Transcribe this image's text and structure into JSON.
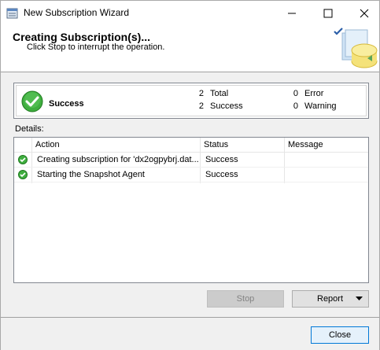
{
  "window": {
    "title": "New Subscription Wizard"
  },
  "header": {
    "title": "Creating Subscription(s)...",
    "subtitle": "Click Stop to interrupt the operation."
  },
  "summary": {
    "status": "Success",
    "total_count": "2",
    "total_label": "Total",
    "success_count": "2",
    "success_label": "Success",
    "error_count": "0",
    "error_label": "Error",
    "warning_count": "0",
    "warning_label": "Warning"
  },
  "details": {
    "label": "Details:",
    "columns": {
      "action": "Action",
      "status": "Status",
      "message": "Message"
    },
    "rows": [
      {
        "action": "Creating subscription for 'dx2ogpybrj.dat...",
        "status": "Success",
        "message": "",
        "icon": "success-icon"
      },
      {
        "action": "Starting the Snapshot Agent",
        "status": "Success",
        "message": "",
        "icon": "success-icon"
      }
    ]
  },
  "buttons": {
    "stop": "Stop",
    "report": "Report",
    "close": "Close"
  },
  "colors": {
    "success_green": "#2e9e2e",
    "accent": "#0078d7"
  }
}
